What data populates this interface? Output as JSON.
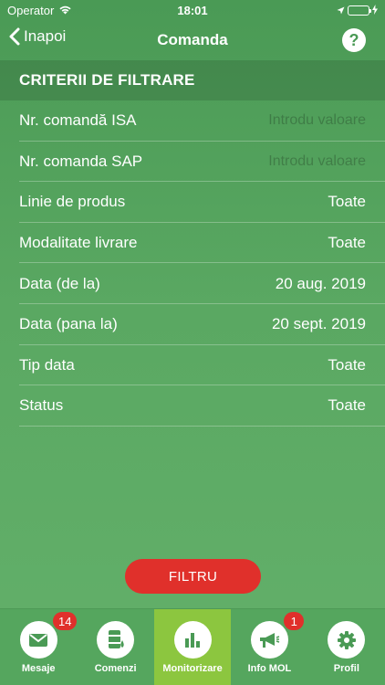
{
  "status_bar": {
    "carrier": "Operator",
    "time": "18:01"
  },
  "nav": {
    "back_label": "Inapoi",
    "title": "Comanda",
    "help_label": "?"
  },
  "filter": {
    "header": "CRITERII DE FILTRARE",
    "rows": [
      {
        "label": "Nr. comandă ISA",
        "value": "",
        "placeholder": "Introdu valoare"
      },
      {
        "label": "Nr. comanda SAP",
        "value": "",
        "placeholder": "Introdu valoare"
      },
      {
        "label": "Linie de produs",
        "value": "Toate"
      },
      {
        "label": "Modalitate livrare",
        "value": "Toate"
      },
      {
        "label": "Data (de la)",
        "value": "20 aug. 2019"
      },
      {
        "label": "Data (pana la)",
        "value": "20 sept. 2019"
      },
      {
        "label": "Tip data",
        "value": "Toate"
      },
      {
        "label": "Status",
        "value": "Toate"
      }
    ],
    "button_label": "FILTRU"
  },
  "tabs": [
    {
      "label": "Mesaje",
      "icon": "mail-icon",
      "badge": "14",
      "active": false
    },
    {
      "label": "Comenzi",
      "icon": "fuel-barrel-icon",
      "active": false
    },
    {
      "label": "Monitorizare",
      "icon": "bar-chart-icon",
      "active": true
    },
    {
      "label": "Info MOL",
      "icon": "megaphone-icon",
      "badge": "1",
      "active": false
    },
    {
      "label": "Profil",
      "icon": "gear-icon",
      "active": false
    }
  ],
  "colors": {
    "primary_green": "#4a9a55",
    "active_tab": "#8cc63f",
    "accent_red": "#e0302b"
  }
}
